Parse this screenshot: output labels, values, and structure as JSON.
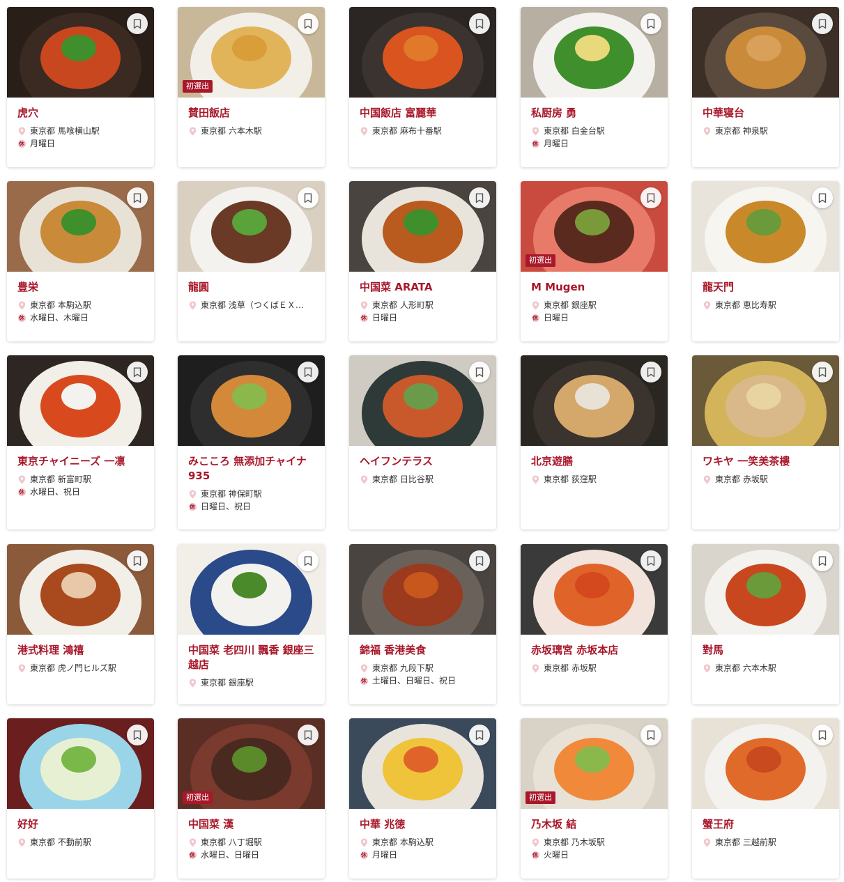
{
  "badge_label": "初選出",
  "icons": {
    "location": "map-pin-icon",
    "holiday": "holiday-icon",
    "bookmark": "bookmark-icon"
  },
  "colors": {
    "accent": "#a8182a",
    "badge_bg": "#a8182a"
  },
  "restaurants": [
    {
      "name": "虎穴",
      "location": "東京都 馬喰横山駅",
      "holiday": "月曜日",
      "new": false,
      "photo": "noodles"
    },
    {
      "name": "賛田飯店",
      "location": "東京都 六本木駅",
      "holiday": "",
      "new": true,
      "photo": "fried-noodles"
    },
    {
      "name": "中国飯店 富麗華",
      "location": "東京都 麻布十番駅",
      "holiday": "",
      "new": false,
      "photo": "crabs"
    },
    {
      "name": "私厨房 勇",
      "location": "東京都 白金台駅",
      "holiday": "月曜日",
      "new": false,
      "photo": "stir-fry-veg"
    },
    {
      "name": "中華寝台",
      "location": "東京都 神泉駅",
      "holiday": "",
      "new": false,
      "photo": "soup-pot"
    },
    {
      "name": "豊栄",
      "location": "東京都 本駒込駅",
      "holiday": "水曜日、木曜日",
      "new": false,
      "photo": "spicy-fish"
    },
    {
      "name": "龍圓",
      "location": "東京都 浅草（つくばＥＸ…",
      "holiday": "",
      "new": false,
      "photo": "beef-asparagus"
    },
    {
      "name": "中国菜 ARATA",
      "location": "東京都 人形町駅",
      "holiday": "日曜日",
      "new": false,
      "photo": "braised"
    },
    {
      "name": "M Mugen",
      "location": "東京都 銀座駅",
      "holiday": "日曜日",
      "new": true,
      "photo": "kungpao"
    },
    {
      "name": "龍天門",
      "location": "東京都 恵比寿駅",
      "holiday": "",
      "new": false,
      "photo": "abalone"
    },
    {
      "name": "東京チャイニーズ 一凛",
      "location": "東京都 新富町駅",
      "holiday": "水曜日、祝日",
      "new": false,
      "photo": "red-soup"
    },
    {
      "name": "みこころ 無添加チャイナ 935",
      "location": "東京都 神保町駅",
      "holiday": "日曜日、祝日",
      "new": false,
      "photo": "shark-fin"
    },
    {
      "name": "ヘイフンテラス",
      "location": "東京都 日比谷駅",
      "holiday": "",
      "new": false,
      "photo": "shrimp-pan"
    },
    {
      "name": "北京遊膳",
      "location": "東京都 荻窪駅",
      "holiday": "",
      "new": false,
      "photo": "stir-fry-fish"
    },
    {
      "name": "ワキヤ 一笑美茶樓",
      "location": "東京都 赤坂駅",
      "holiday": "",
      "new": false,
      "photo": "gold-plate"
    },
    {
      "name": "港式料理 鴻禧",
      "location": "東京都 虎ノ門ヒルズ駅",
      "holiday": "",
      "new": false,
      "photo": "roast-duck"
    },
    {
      "name": "中国菜 老四川 飄香 銀座三越店",
      "location": "東京都 銀座駅",
      "holiday": "",
      "new": false,
      "photo": "squid-plate"
    },
    {
      "name": "錦福 香港美食",
      "location": "東京都 九段下駅",
      "holiday": "土曜日、日曜日、祝日",
      "new": false,
      "photo": "roast-meat"
    },
    {
      "name": "赤坂璃宮 赤坂本店",
      "location": "東京都 赤坂駅",
      "holiday": "",
      "new": false,
      "photo": "chili-shrimp"
    },
    {
      "name": "對馬",
      "location": "東京都 六本木駅",
      "holiday": "",
      "new": false,
      "photo": "mapo"
    },
    {
      "name": "好好",
      "location": "東京都 不動前駅",
      "holiday": "",
      "new": false,
      "photo": "tofu-salad"
    },
    {
      "name": "中国菜 漢",
      "location": "東京都 八丁堀駅",
      "holiday": "水曜日、日曜日",
      "new": true,
      "photo": "abalone-dark"
    },
    {
      "name": "中華 兆徳",
      "location": "東京都 本駒込駅",
      "holiday": "月曜日",
      "new": false,
      "photo": "egg-tomato"
    },
    {
      "name": "乃木坂 結",
      "location": "東京都 乃木坂駅",
      "holiday": "火曜日",
      "new": true,
      "photo": "prawns"
    },
    {
      "name": "蟹王府",
      "location": "東京都 三越前駅",
      "holiday": "",
      "new": false,
      "photo": "crab-display"
    }
  ]
}
